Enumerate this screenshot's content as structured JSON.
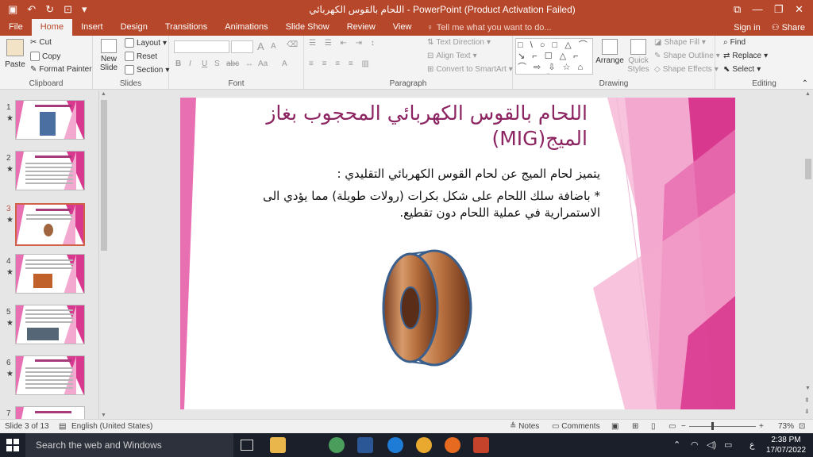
{
  "window": {
    "title": "اللحام بالقوس الكهربائي - PowerPoint (Product Activation Failed)",
    "qat_icons": [
      "save-icon",
      "undo-icon",
      "redo-icon",
      "slideshow-from-beginning-icon",
      "customize-qat-icon"
    ],
    "controls": [
      "minimize-icon",
      "ribbon-display-icon",
      "restore-icon",
      "close-icon"
    ]
  },
  "tabs": {
    "items": [
      "File",
      "Home",
      "Insert",
      "Design",
      "Transitions",
      "Animations",
      "Slide Show",
      "Review",
      "View"
    ],
    "active": "Home",
    "tell_me": "Tell me what you want to do...",
    "sign_in": "Sign in",
    "share": "Share"
  },
  "ribbon": {
    "clipboard": {
      "paste": "Paste",
      "cut": "Cut",
      "copy": "Copy",
      "format_painter": "Format Painter",
      "label": "Clipboard"
    },
    "slides": {
      "new_slide": "New",
      "new_slide2": "Slide",
      "layout": "Layout",
      "reset": "Reset",
      "section": "Section",
      "label": "Slides"
    },
    "font": {
      "bold": "B",
      "italic": "I",
      "underline": "U",
      "strike": "S",
      "spacing": "abc",
      "case": "Aa",
      "size_up": "A",
      "size_down": "A",
      "label": "Font"
    },
    "paragraph": {
      "text_direction": "Text Direction",
      "align_text": "Align Text",
      "smartart": "Convert to SmartArt",
      "label": "Paragraph"
    },
    "drawing": {
      "arrange": "Arrange",
      "quick_styles": "Quick",
      "quick_styles2": "Styles",
      "shape_fill": "Shape Fill",
      "shape_outline": "Shape Outline",
      "shape_effects": "Shape Effects",
      "label": "Drawing",
      "shape_glyphs": "□ \\ ○ □ △ ⌒ ↘ ⌐ ☐ △ ⌐ ⌒ ⇨ ⇩ ☆ ⌂ △ ⌐ ⌒ { } ☆"
    },
    "editing": {
      "find": "Find",
      "replace": "Replace",
      "select": "Select",
      "label": "Editing"
    }
  },
  "thumbnails": [
    {
      "num": "1",
      "star": "★"
    },
    {
      "num": "2",
      "star": "★"
    },
    {
      "num": "3",
      "star": "★"
    },
    {
      "num": "4",
      "star": "★"
    },
    {
      "num": "5",
      "star": "★"
    },
    {
      "num": "6",
      "star": "★"
    },
    {
      "num": "7",
      "star": ""
    }
  ],
  "selected_slide": 3,
  "slide": {
    "title": "اللحام بالقوس الكهربائي المحجوب بغاز الميج(MIG)",
    "body_line1": "يتميز لحام الميج عن لحام القوس الكهربائي التقليدي :",
    "body_line2": "* باضافة سلك اللحام على شكل بكرات (رولات طويلة) مما يؤدي الى الاستمرارية في عملية اللحام دون تقطيع.",
    "image": "wire-spool-image"
  },
  "statusbar": {
    "slide_info": "Slide 3 of 13",
    "language": "English (United States)",
    "notes": "Notes",
    "comments": "Comments",
    "zoom": "73%",
    "zoom_percent": 73
  },
  "taskbar": {
    "search_placeholder": "Search the web and Windows",
    "apps": [
      "file-explorer-icon",
      "chrome-icon",
      "word-icon",
      "edge-icon",
      "chrome-alt-icon",
      "firefox-icon",
      "powerpoint-icon"
    ],
    "lang": "ع",
    "time": "2:38 PM",
    "date": "17/07/2022"
  },
  "colors": {
    "accent": "#b7472a",
    "title_text": "#8c2461",
    "pink_light": "#f3a9cf",
    "pink_mid": "#e86fb1",
    "pink_dark": "#d9388f"
  }
}
